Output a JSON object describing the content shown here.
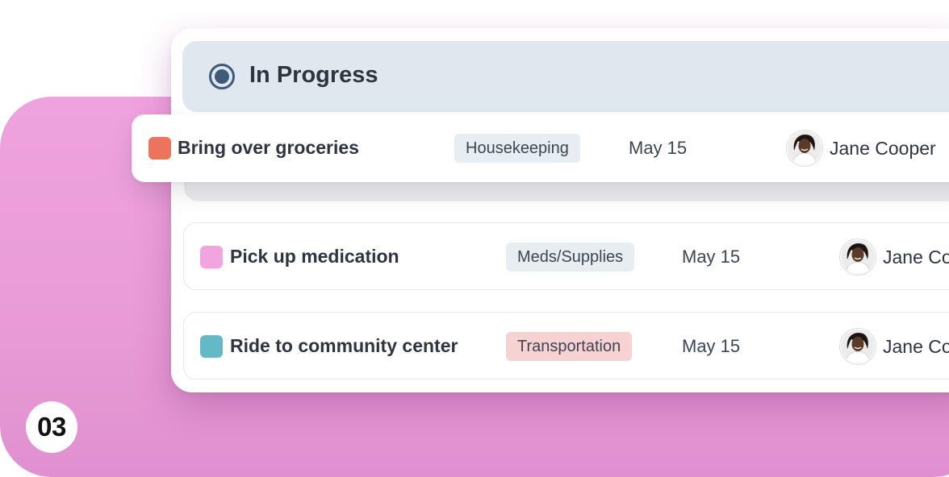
{
  "step_number": "03",
  "column": {
    "title": "In Progress",
    "status_icon": "radio-selected-icon",
    "color": "#3e5a78"
  },
  "tasks": [
    {
      "title": "Bring over groceries",
      "category": "Housekeeping",
      "category_color": "#e8edf1",
      "swatch_color": "#ec735c",
      "due": "May 15",
      "assignee": "Jane Cooper",
      "avatar": "avatar-icon"
    },
    {
      "title": "Pick up medication",
      "category": "Meds/Supplies",
      "category_color": "#e8edf1",
      "swatch_color": "#f1a4dd",
      "due": "May 15",
      "assignee": "Jane Cooper",
      "avatar": "avatar-icon"
    },
    {
      "title": "Ride to community center",
      "category": "Transportation",
      "category_color": "#f6d3d2",
      "swatch_color": "#64b9c6",
      "due": "May 15",
      "assignee": "Jane Cooper",
      "avatar": "avatar-icon"
    }
  ],
  "colors": {
    "accent_pink": "#ed9fdb",
    "header_bg": "#e1e7ee"
  }
}
